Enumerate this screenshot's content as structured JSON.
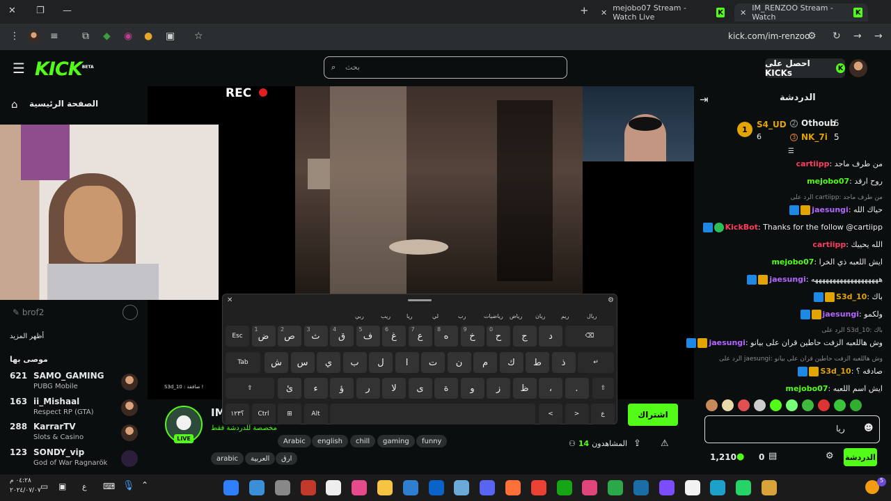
{
  "browser": {
    "tabs": [
      {
        "title": "mejobo07 Stream - Watch Live",
        "active": false
      },
      {
        "title": "IM_RENZOO Stream - Watch",
        "active": true
      }
    ],
    "url": "kick.com/im-renzoo"
  },
  "header": {
    "logo": "KICK",
    "logo_badge": "BETA",
    "search_placeholder": "بحث",
    "get_kicks": "احصل على KICKs"
  },
  "sidebar": {
    "home": "الصفحة الرئيسية",
    "show_more": "أظهر المزيد",
    "recommended_title": "موصى بها",
    "streamer_name": "brof2",
    "items": [
      {
        "viewers": "621",
        "name": "SAMO_GAMING",
        "game": "PUBG Mobile"
      },
      {
        "viewers": "163",
        "name": "ii_Mishaal",
        "game": "Respect RP (GTA)"
      },
      {
        "viewers": "288",
        "name": "KarrarTV",
        "game": "Slots & Casino"
      },
      {
        "viewers": "123",
        "name": "SONDY_vip",
        "game": "God of War Ragnarök"
      }
    ]
  },
  "video": {
    "rec_label": "REC",
    "webcam_overlay": "S3d_10 : صافقة !"
  },
  "stream_info": {
    "channel_initials": "IM",
    "live_label": "LIVE",
    "title_fragment": "مخصصة للدردشة فقط",
    "tags": [
      "Arabic",
      "english",
      "chill",
      "gaming",
      "funny",
      "arabic",
      "العربية",
      "ارق"
    ],
    "viewers_label": "المشاهدون",
    "viewers_count": "14",
    "subscribe_label": "اشتراك"
  },
  "chat": {
    "title": "الدردشة",
    "leaderboard": [
      {
        "rank": "1",
        "name": "S4_UD",
        "count": "6"
      },
      {
        "rank": "2",
        "name": "Othoub",
        "count": "5"
      },
      {
        "rank": "3",
        "name": "NK_7i",
        "count": "5"
      }
    ],
    "messages": [
      {
        "user": "cartiipp",
        "text": "من طرف ماجد",
        "color": "#ff3b5c"
      },
      {
        "user": "mejobo07",
        "text": "روح ارقد",
        "color": "#53fc18"
      },
      {
        "reply": "الرد على cartiipp: من طرف ماجد"
      },
      {
        "user": "jaesungi",
        "text": "حياك الله",
        "color": "#b266ff",
        "badges": true
      },
      {
        "user": "KickBot",
        "text": "Thanks for the follow @cartiipp",
        "color": "#ff3b5c",
        "badges": true
      },
      {
        "user": "cartiipp",
        "text": "الله يحييك",
        "color": "#ff3b5c"
      },
      {
        "user": "mejobo07",
        "text": "ايش اللعبه ذي الخرا",
        "color": "#53fc18"
      },
      {
        "user": "jaesungi",
        "text": "هههههههههههههههههههه",
        "color": "#b266ff",
        "badges": true
      },
      {
        "user": "S3d_10",
        "text": "باك",
        "color": "#e2a400",
        "badges": true
      },
      {
        "user": "jaesungi",
        "text": "ولكمو",
        "color": "#b266ff",
        "badges": true
      },
      {
        "reply": "الرد على S3d_10: باك"
      },
      {
        "user": "jaesungi",
        "text": "وش هاللعبه الزفت حاطين قران على بيانو",
        "color": "#b266ff",
        "badges": true
      },
      {
        "reply": "الرد على jaesungi: وش هاللعبه الزفت حاطين قران على بيانو"
      },
      {
        "user": "S3d_10",
        "text": "صادقه ؟",
        "color": "#e2a400",
        "badges": true
      },
      {
        "user": "mejobo07",
        "text": "ايش اسم اللعبه",
        "color": "#53fc18"
      }
    ],
    "input_value": "ريا",
    "points": "1,210",
    "kicks": "0",
    "send_label": "الدردشة"
  },
  "keyboard": {
    "suggestions": [
      "ريال",
      "ريم",
      "ريان",
      "رياض",
      "رياضيات",
      "رب",
      "لي",
      "ريا",
      "ريب",
      "ربي"
    ],
    "row1": [
      [
        "Esc",
        ""
      ],
      [
        "ض",
        "1"
      ],
      [
        "ص",
        "2"
      ],
      [
        "ث",
        "3"
      ],
      [
        "ق",
        "4"
      ],
      [
        "ف",
        "5"
      ],
      [
        "غ",
        "6"
      ],
      [
        "ع",
        "7"
      ],
      [
        "ه",
        "8"
      ],
      [
        "خ",
        "9"
      ],
      [
        "ح",
        "0"
      ],
      [
        "ج",
        ""
      ],
      [
        "د",
        ""
      ]
    ],
    "row2": [
      [
        "Tab",
        ""
      ],
      [
        "ش",
        ""
      ],
      [
        "س",
        ""
      ],
      [
        "ي",
        ""
      ],
      [
        "ب",
        ""
      ],
      [
        "ل",
        ""
      ],
      [
        "ا",
        ""
      ],
      [
        "ت",
        ""
      ],
      [
        "ن",
        ""
      ],
      [
        "م",
        ""
      ],
      [
        "ك",
        ""
      ],
      [
        "ط",
        ""
      ],
      [
        "ذ",
        ""
      ]
    ],
    "row3": [
      [
        "ئ",
        ""
      ],
      [
        "ء",
        ""
      ],
      [
        "ؤ",
        ""
      ],
      [
        "ر",
        ""
      ],
      [
        "لا",
        ""
      ],
      [
        "ى",
        ""
      ],
      [
        "ة",
        ""
      ],
      [
        "و",
        ""
      ],
      [
        "ز",
        ""
      ],
      [
        "ظ",
        ""
      ],
      [
        "،",
        ""
      ],
      [
        ".",
        ""
      ]
    ],
    "row4_left": [
      "؟١٢٣",
      "Ctrl",
      "⊞",
      "Alt"
    ],
    "row4_right": [
      "<",
      ">",
      "ع"
    ]
  },
  "taskbar": {
    "time": "٠٤:٢٨ م",
    "date": "٢٠٢٤/٠٧/٠٧",
    "lang": "ع",
    "notification_count": "5"
  }
}
